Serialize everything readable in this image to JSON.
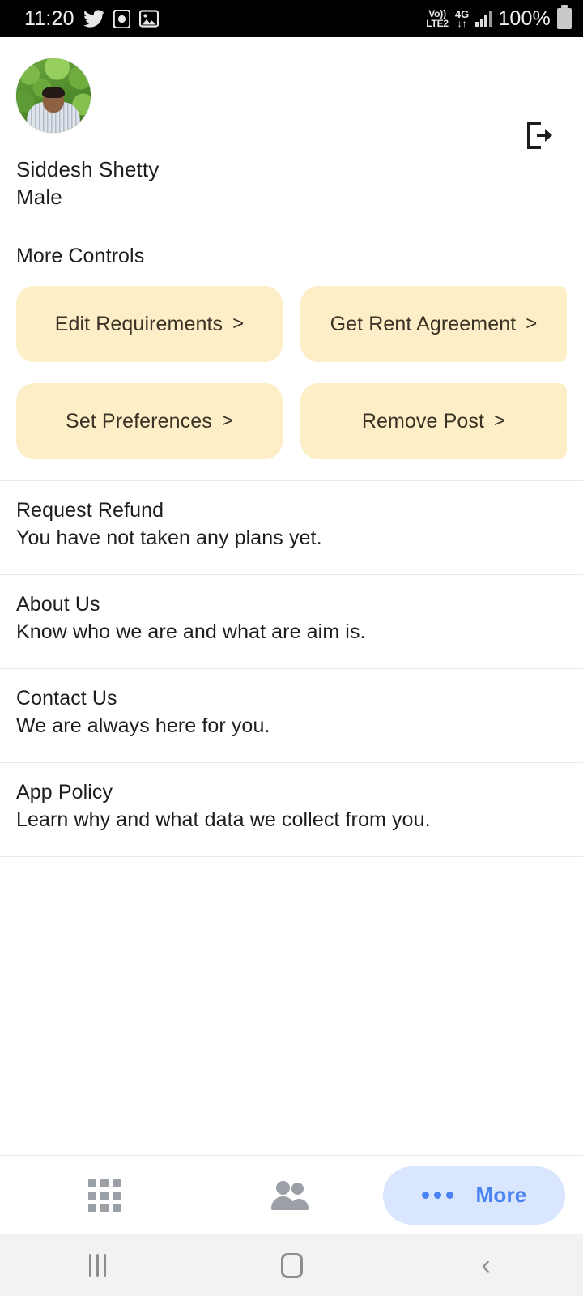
{
  "statusbar": {
    "time": "11:20",
    "left_icons": [
      "twitter-icon",
      "clock-icon",
      "photos-icon"
    ],
    "volte_top": "Vo))",
    "volte_bottom": "LTE2",
    "network": "4G",
    "network_arrows": "↓↑",
    "battery_percent": "100%",
    "signal_icon": "signal-bars-icon",
    "battery_icon": "battery-full-icon"
  },
  "profile": {
    "name": "Siddesh Shetty",
    "gender": "Male",
    "avatar_name": "user-avatar",
    "logout_icon": "logout-icon"
  },
  "controls": {
    "section_title": "More Controls",
    "chevron": ">",
    "button_color": "#fdeec7",
    "buttons": [
      {
        "label": "Edit Requirements",
        "name": "edit-requirements-button"
      },
      {
        "label": "Get Rent Agreement",
        "name": "get-rent-agreement-button"
      },
      {
        "label": "Set Preferences",
        "name": "set-preferences-button"
      },
      {
        "label": "Remove Post",
        "name": "remove-post-button"
      }
    ]
  },
  "list": [
    {
      "title": "Request Refund",
      "subtitle": "You have not taken any plans yet."
    },
    {
      "title": "About Us",
      "subtitle": "Know who we are and what are aim is."
    },
    {
      "title": "Contact Us",
      "subtitle": "We are always here for you."
    },
    {
      "title": "App Policy",
      "subtitle": "Learn why and what data we collect from you."
    }
  ],
  "tabbar": {
    "accent": "#4a84f3",
    "active_pill_bg": "#d9e6fd",
    "inactive_color": "#9aa0a6",
    "tabs": [
      {
        "label": "",
        "icon": "grid-icon",
        "name": "tab-explore",
        "active": false
      },
      {
        "label": "",
        "icon": "people-icon",
        "name": "tab-people",
        "active": false
      },
      {
        "label": "More",
        "icon": "more-dots-icon",
        "name": "tab-more",
        "active": true
      }
    ]
  },
  "sysnav": {
    "recents_icon": "recents-icon",
    "home_icon": "home-icon",
    "back_icon": "back-icon",
    "back_glyph": "‹"
  }
}
